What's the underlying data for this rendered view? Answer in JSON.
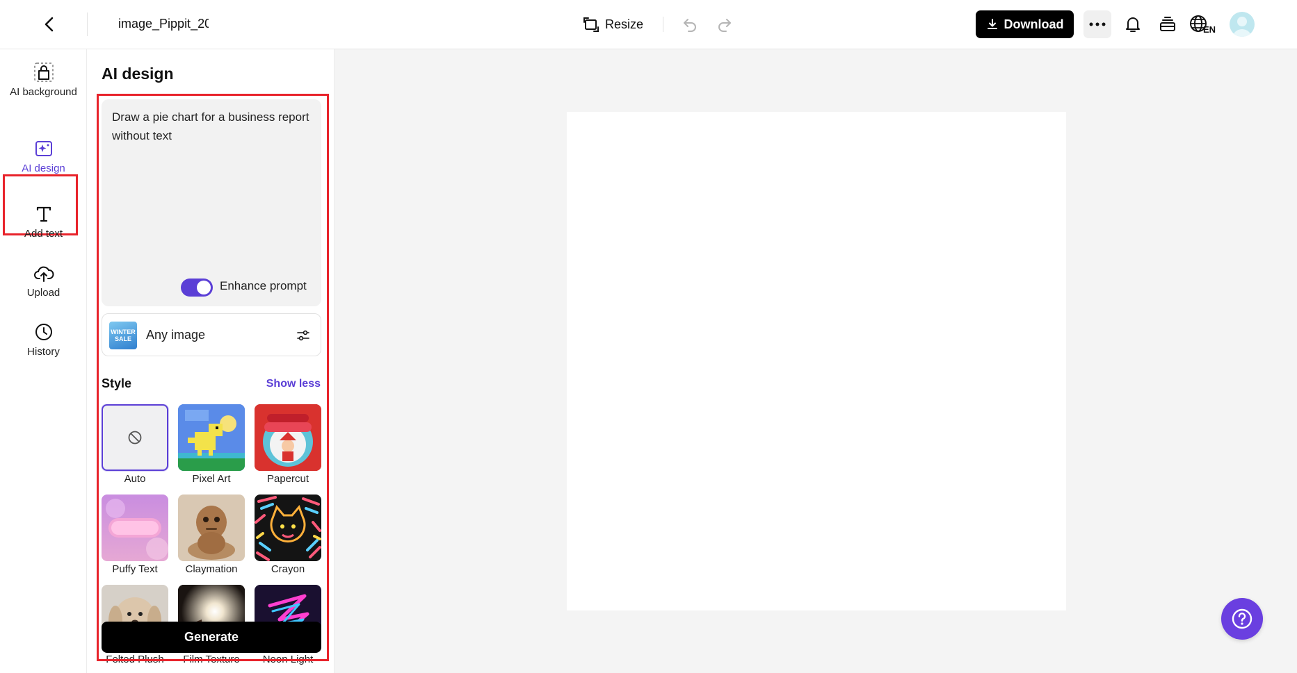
{
  "header": {
    "file_title": "image_Pippit_20",
    "resize_label": "Resize",
    "download_label": "Download",
    "language_code": "EN"
  },
  "rail": {
    "items": [
      {
        "id": "ai-background",
        "label": "AI background",
        "icon": "bag-dashed-icon"
      },
      {
        "id": "ai-design",
        "label": "AI design",
        "icon": "sparkle-image-icon",
        "active": true
      },
      {
        "id": "add-text",
        "label": "Add text",
        "icon": "text-t-icon"
      },
      {
        "id": "upload",
        "label": "Upload",
        "icon": "cloud-upload-icon"
      },
      {
        "id": "history",
        "label": "History",
        "icon": "clock-icon"
      }
    ]
  },
  "panel": {
    "title": "AI design",
    "prompt": "Draw a pie chart for a business report without text",
    "enhance_label": "Enhance prompt",
    "enhance_on": true,
    "image_type_label": "Any image",
    "image_thumb_text": "WINTER SALE",
    "style_label": "Style",
    "show_less_label": "Show less",
    "styles": [
      {
        "label": "Auto",
        "selected": true
      },
      {
        "label": "Pixel Art"
      },
      {
        "label": "Papercut"
      },
      {
        "label": "Puffy Text"
      },
      {
        "label": "Claymation"
      },
      {
        "label": "Crayon"
      },
      {
        "label": "Felted Plush"
      },
      {
        "label": "Film Texture"
      },
      {
        "label": "Neon Light"
      }
    ],
    "generate_label": "Generate"
  },
  "colors": {
    "accent": "#5b3fd6",
    "highlight": "#e8232b",
    "help_button": "#6a3fe0"
  }
}
